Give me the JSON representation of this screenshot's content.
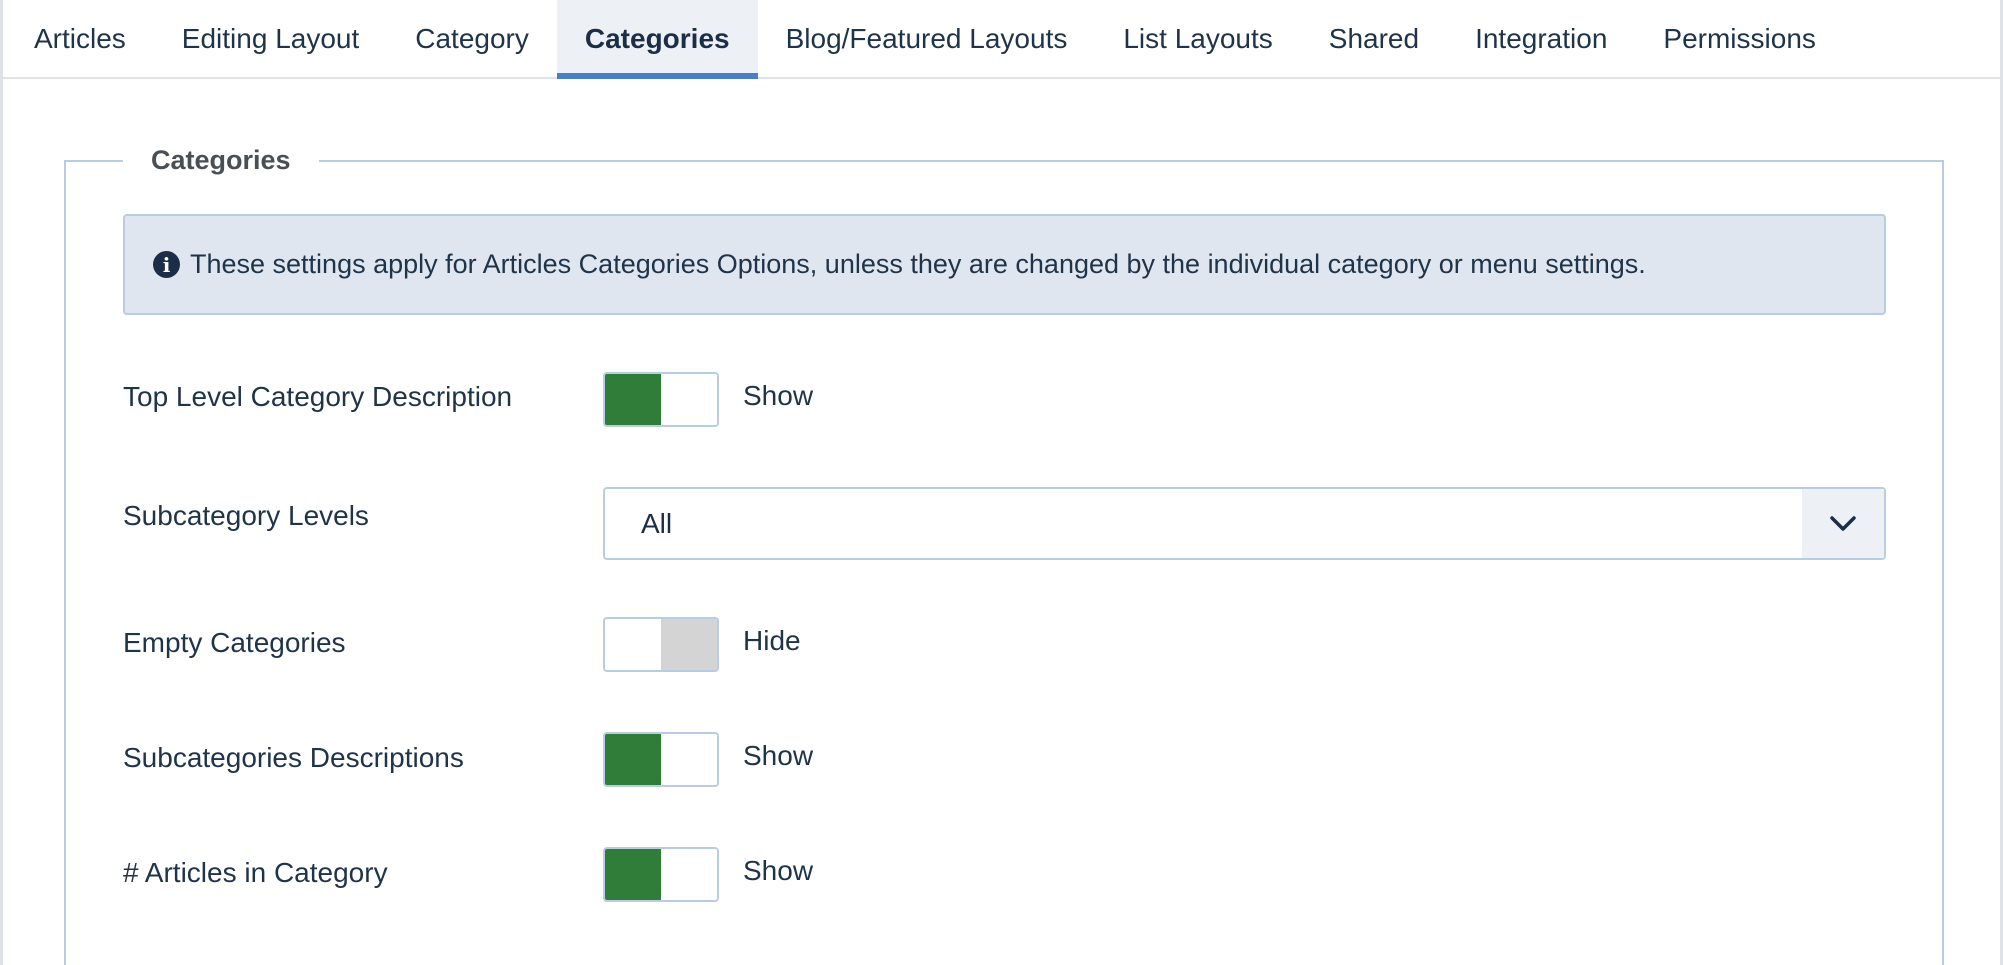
{
  "tabs": [
    {
      "label": "Articles"
    },
    {
      "label": "Editing Layout"
    },
    {
      "label": "Category"
    },
    {
      "label": "Categories",
      "active": true
    },
    {
      "label": "Blog/Featured Layouts"
    },
    {
      "label": "List Layouts"
    },
    {
      "label": "Shared"
    },
    {
      "label": "Integration"
    },
    {
      "label": "Permissions"
    }
  ],
  "fieldset": {
    "legend": "Categories",
    "alert": {
      "icon": "info-icon",
      "text": "These settings apply for Articles Categories Options, unless they are changed by the individual category or menu settings."
    },
    "fields": {
      "top_level_desc": {
        "label": "Top Level Category Description",
        "value": "Show",
        "state": "on"
      },
      "subcategory_levels": {
        "label": "Subcategory Levels",
        "value": "All"
      },
      "empty_categories": {
        "label": "Empty Categories",
        "value": "Hide",
        "state": "off"
      },
      "subcategories_desc": {
        "label": "Subcategories Descriptions",
        "value": "Show",
        "state": "on"
      },
      "articles_in_category": {
        "label": "# Articles in Category",
        "value": "Show",
        "state": "on"
      }
    }
  },
  "colors": {
    "accent": "#4a7fc8",
    "switch_on": "#2f7d39",
    "switch_off": "#d4d4d4",
    "alert_bg": "#dfe6f0",
    "text": "#1f3349"
  }
}
